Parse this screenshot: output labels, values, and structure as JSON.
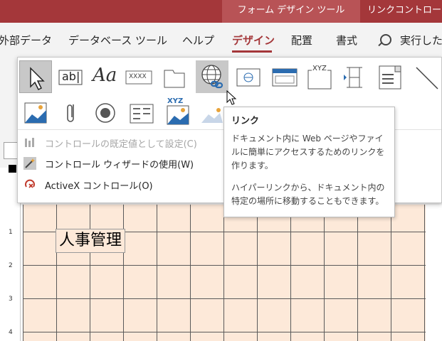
{
  "titlebar": {
    "context_tab_1": "フォーム デザイン ツール",
    "context_tab_2": "リンクコントロール"
  },
  "ribbon_tabs": [
    {
      "label": "外部データ"
    },
    {
      "label": "データベース ツール"
    },
    {
      "label": "ヘルプ"
    },
    {
      "label": "デザイン",
      "active": true
    },
    {
      "label": "配置"
    },
    {
      "label": "書式"
    }
  ],
  "search": {
    "label": "実行したい"
  },
  "gallery": {
    "row1": [
      "select-pointer-icon",
      "textbox-icon",
      "label-icon",
      "button-icon",
      "tab-control-icon",
      "hyperlink-icon",
      "web-browser-icon",
      "navigation-icon",
      "option-group-icon",
      "page-break-icon",
      "combo-box-icon",
      "line-icon"
    ],
    "row2": [
      "chart-icon",
      "attachment-icon",
      "option-button-icon",
      "list-box-icon",
      "image-icon",
      "unbound-object-icon"
    ],
    "textbox_glyph": "ab|",
    "label_glyph": "Aa",
    "button_glyph": "XXXX",
    "option_group_glyph": "XYZ",
    "image_glyph": "XYZ"
  },
  "menu": {
    "items": [
      {
        "label": "コントロールの既定値として設定(C)",
        "disabled": true
      },
      {
        "label": "コントロール ウィザードの使用(W)",
        "disabled": false
      },
      {
        "label": "ActiveX コントロール(O)",
        "disabled": false
      }
    ]
  },
  "tooltip": {
    "title": "リンク",
    "line1": "ドキュメント内に Web ページやファイルに簡単にアクセスするためのリンクを作ります。",
    "line2": "ハイパーリンクから、ドキュメント内の特定の場所に移動することもできます。"
  },
  "form": {
    "label_text": "人事管理"
  },
  "ruler": {
    "numbers": [
      "1",
      "2",
      "3",
      "4"
    ]
  },
  "colors": {
    "accent": "#a4373a",
    "grid_bg": "#fde9d9"
  }
}
